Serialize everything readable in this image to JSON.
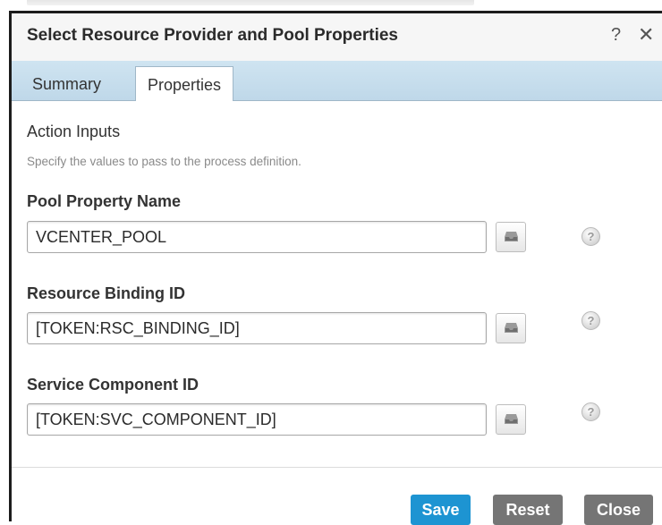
{
  "dialog": {
    "title": "Select Resource Provider and Pool Properties",
    "help_glyph": "?",
    "close_glyph": "✕"
  },
  "tabs": [
    {
      "label": "Summary",
      "active": false
    },
    {
      "label": "Properties",
      "active": true
    }
  ],
  "section": {
    "title": "Action Inputs",
    "description": "Specify the values to pass to the process definition."
  },
  "fields": [
    {
      "label": "Pool Property Name",
      "value": "VCENTER_POOL"
    },
    {
      "label": "Resource Binding ID",
      "value": "[TOKEN:RSC_BINDING_ID]"
    },
    {
      "label": "Service Component ID",
      "value": "[TOKEN:SVC_COMPONENT_ID]"
    }
  ],
  "field_help_glyph": "?",
  "footer": {
    "save_label": "Save",
    "reset_label": "Reset",
    "close_label": "Close"
  },
  "colors": {
    "primary_button": "#1d94d2",
    "secondary_button": "#757575",
    "tab_strip": "#c7dfee"
  },
  "icons": {
    "field_picker": "tray-icon",
    "field_help": "help-circle-icon"
  }
}
